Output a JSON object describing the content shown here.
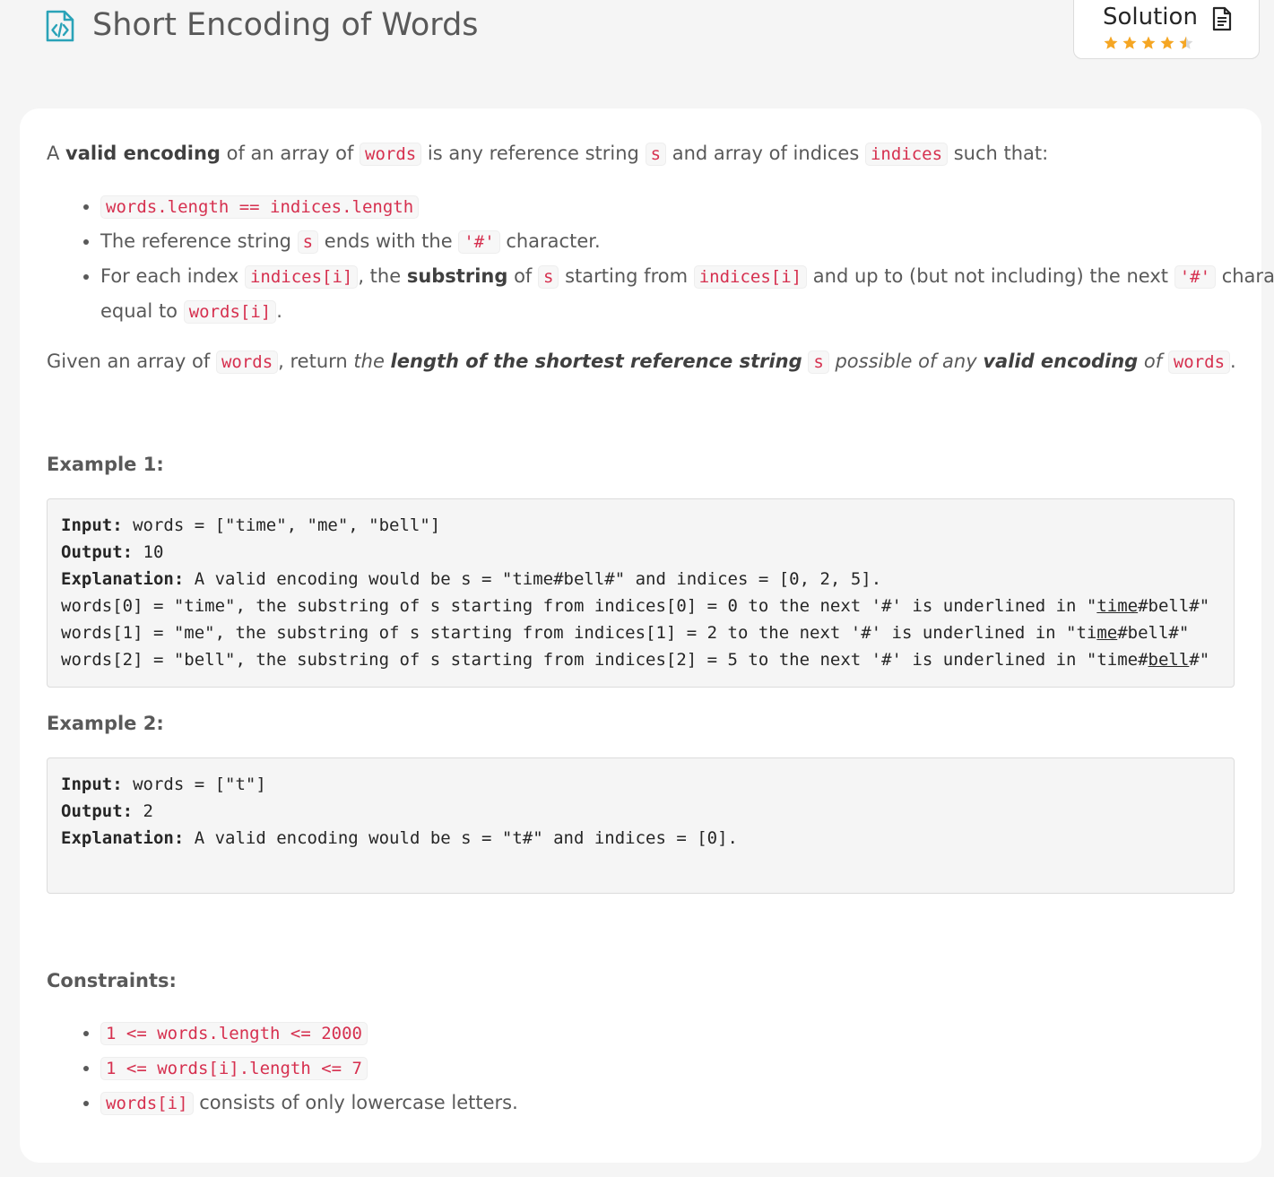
{
  "problem": {
    "title": "Short Encoding of Words"
  },
  "solution": {
    "label": "Solution",
    "rating": 4.5,
    "star_color": "#f5a623"
  },
  "description": {
    "p1": {
      "t1": "A ",
      "b1": "valid encoding",
      "t2": " of an array of ",
      "c1": "words",
      "t3": " is any reference string ",
      "c2": "s",
      "t4": " and array of indices ",
      "c3": "indices",
      "t5": " such that:"
    },
    "bullets": {
      "b1": {
        "c1": "words.length == indices.length"
      },
      "b2": {
        "t1": "The reference string ",
        "c1": "s",
        "t2": " ends with the ",
        "c2": "'#'",
        "t3": " character."
      },
      "b3": {
        "t1": "For each index ",
        "c1": "indices[i]",
        "t2": ", the ",
        "b1": "substring",
        "t3": " of ",
        "c2": "s",
        "t4": " starting from ",
        "c3": "indices[i]",
        "t5": " and up to (but not including) the next ",
        "c4": "'#'",
        "t6": " character is",
        "t7": "equal to ",
        "c5": "words[i]",
        "t8": "."
      }
    },
    "p2": {
      "t1": "Given an array of ",
      "c1": "words",
      "t2": ", return ",
      "i1": "the ",
      "bi1": "length of the shortest reference string",
      "t3": " ",
      "c2": "s",
      "i2": " possible of any ",
      "bi2": "valid encoding",
      "i3": " of ",
      "c3": "words",
      "t4": "."
    }
  },
  "examples": [
    {
      "title": "Example 1:",
      "input_label": "Input:",
      "input_value": " words = [\"time\", \"me\", \"bell\"]",
      "output_label": "Output:",
      "output_value": " 10",
      "explanation_label": "Explanation:",
      "explanation_value": " A valid encoding would be s = \"time#bell#\" and indices = [0, 2, 5].",
      "lines": [
        {
          "pre": "words[0] = \"time\", the substring of s starting from indices[0] = 0 to the next '#' is underlined in \"",
          "u": "time",
          "post": "#bell#\""
        },
        {
          "pre": "words[1] = \"me\", the substring of s starting from indices[1] = 2 to the next '#' is underlined in \"ti",
          "u": "me",
          "post": "#bell#\""
        },
        {
          "pre": "words[2] = \"bell\", the substring of s starting from indices[2] = 5 to the next '#' is underlined in \"time#",
          "u": "bell",
          "post": "#\""
        }
      ]
    },
    {
      "title": "Example 2:",
      "input_label": "Input:",
      "input_value": " words = [\"t\"]",
      "output_label": "Output:",
      "output_value": " 2",
      "explanation_label": "Explanation:",
      "explanation_value": " A valid encoding would be s = \"t#\" and indices = [0]."
    }
  ],
  "constraints": {
    "title": "Constraints:",
    "items": [
      {
        "code": "1 <= words.length <= 2000",
        "text": ""
      },
      {
        "code": "1 <= words[i].length <= 7",
        "text": ""
      },
      {
        "code": "words[i]",
        "text": " consists of only lowercase letters."
      }
    ]
  }
}
